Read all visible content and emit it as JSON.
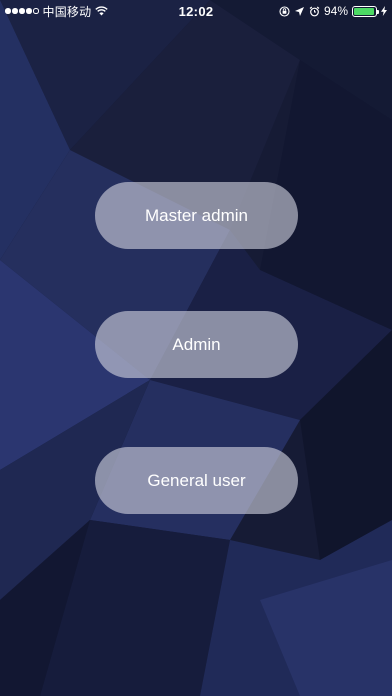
{
  "status_bar": {
    "carrier": "中国移动",
    "time": "12:02",
    "battery_percent": "94%",
    "battery_level": 0.94,
    "signal_bars_filled": 4,
    "signal_bars_total": 5,
    "icons": [
      "wifi-icon",
      "orientation-lock-icon",
      "location-icon",
      "alarm-icon",
      "battery-icon",
      "charging-bolt-icon"
    ]
  },
  "login": {
    "master_admin_label": "Master admin",
    "admin_label": "Admin",
    "general_user_label": "General user"
  },
  "theme": {
    "background": "#161b35",
    "button_fill": "rgba(208,210,222,0.62)",
    "battery_green": "#4cd964"
  }
}
